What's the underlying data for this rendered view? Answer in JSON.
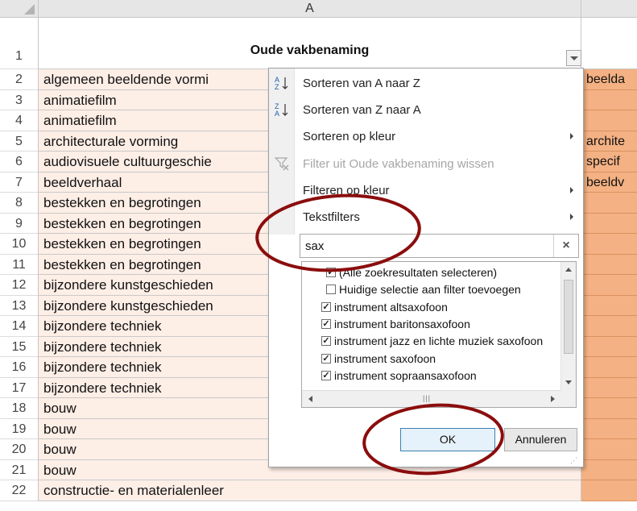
{
  "column_header": "A",
  "header_cell": "Oude vakbenaming",
  "rows": [
    {
      "n": "1"
    },
    {
      "n": "2",
      "a": "algemeen beeldende vormi",
      "b": "beelda"
    },
    {
      "n": "3",
      "a": "animatiefilm",
      "b": ""
    },
    {
      "n": "4",
      "a": "animatiefilm",
      "b": ""
    },
    {
      "n": "5",
      "a": "architecturale vorming",
      "b": "archite"
    },
    {
      "n": "6",
      "a": "audiovisuele cultuurgeschie",
      "b": "specif"
    },
    {
      "n": "7",
      "a": "beeldverhaal",
      "b": "beeldv"
    },
    {
      "n": "8",
      "a": "bestekken en begrotingen",
      "b": ""
    },
    {
      "n": "9",
      "a": "bestekken en begrotingen",
      "b": ""
    },
    {
      "n": "10",
      "a": "bestekken en begrotingen",
      "b": ""
    },
    {
      "n": "11",
      "a": "bestekken en begrotingen",
      "b": ""
    },
    {
      "n": "12",
      "a": "bijzondere kunstgeschieden",
      "b": ""
    },
    {
      "n": "13",
      "a": "bijzondere kunstgeschieden",
      "b": ""
    },
    {
      "n": "14",
      "a": "bijzondere techniek",
      "b": ""
    },
    {
      "n": "15",
      "a": "bijzondere techniek",
      "b": ""
    },
    {
      "n": "16",
      "a": "bijzondere techniek",
      "b": ""
    },
    {
      "n": "17",
      "a": "bijzondere techniek",
      "b": ""
    },
    {
      "n": "18",
      "a": "bouw",
      "b": ""
    },
    {
      "n": "19",
      "a": "bouw",
      "b": ""
    },
    {
      "n": "20",
      "a": "bouw",
      "b": ""
    },
    {
      "n": "21",
      "a": "bouw",
      "b": ""
    },
    {
      "n": "22",
      "a": "constructie- en materialenleer",
      "b": ""
    }
  ],
  "menu": {
    "sort_az": "Sorteren van A naar Z",
    "sort_za": "Sorteren van Z naar A",
    "sort_color": "Sorteren op kleur",
    "clear_filter": "Filter uit Oude vakbenaming wissen",
    "filter_color": "Filteren op kleur",
    "text_filters": "Tekstfilters"
  },
  "search": {
    "value": "sax",
    "clear_symbol": "×"
  },
  "list_items": [
    {
      "label": "(Alle zoekresultaten selecteren)",
      "checked": true
    },
    {
      "label": "Huidige selectie aan filter toevoegen",
      "checked": false
    },
    {
      "label": "instrument altsaxofoon",
      "checked": true
    },
    {
      "label": "instrument baritonsaxofoon",
      "checked": true
    },
    {
      "label": "instrument jazz en lichte muziek saxofoon",
      "checked": true
    },
    {
      "label": "instrument saxofoon",
      "checked": true
    },
    {
      "label": "instrument sopraansaxofoon",
      "checked": true
    }
  ],
  "buttons": {
    "ok": "OK",
    "cancel": "Annuleren"
  },
  "colors": {
    "cell_a": "#fdeee6",
    "cell_b": "#f4b183",
    "annotation": "#8b0d0d"
  }
}
